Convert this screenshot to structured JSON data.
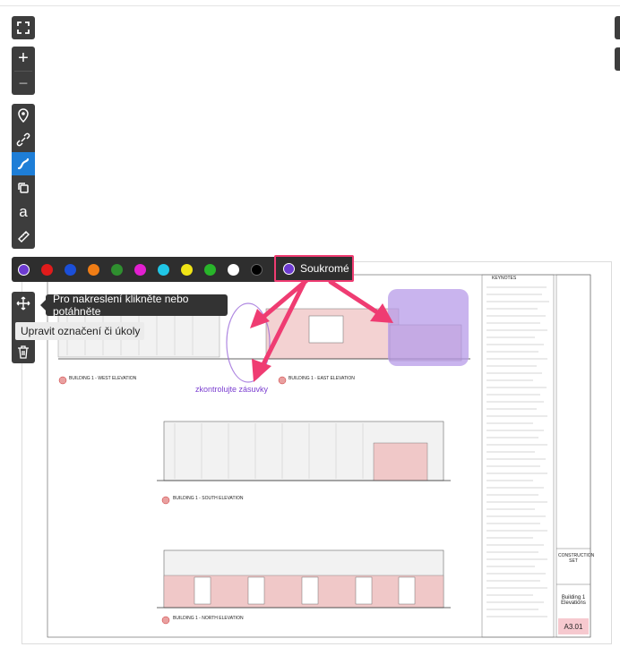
{
  "toolbar": {
    "fullscreen": "fullscreen-icon",
    "zoom_in": "+",
    "zoom_out": "−",
    "text_tool": "a"
  },
  "colors": {
    "accent": "#1e7ed7",
    "annotation_pink": "#ef3c72",
    "annotation_purple": "#8b58d6",
    "palette": [
      "#6d3bd1",
      "#e11b1b",
      "#1b4fd8",
      "#f07d15",
      "#2f8f2f",
      "#e21fd0",
      "#20c6e6",
      "#f0e416",
      "#28b52a",
      "#ffffff",
      "#000000"
    ]
  },
  "private_button": {
    "label": "Soukromé"
  },
  "tooltip": {
    "text": "Pro nakreslení klikněte nebo potáhněte"
  },
  "edit_label": {
    "text": "Upravit označení či úkoly"
  },
  "annotation": {
    "text": "zkontrolujte zásuvky"
  },
  "drawing": {
    "keynotes_header": "KEYNOTES",
    "west_elevation": "BUILDING 1 - WEST ELEVATION",
    "east_elevation": "BUILDING 1 - EAST ELEVATION",
    "south_elevation": "BUILDING 1 - SOUTH ELEVATION",
    "north_elevation": "BUILDING 1 - NORTH ELEVATION",
    "stamp_title": "CONSTRUCTION SET",
    "sheet_title": "Building 1 Elevations",
    "sheet_number": "A3.01"
  }
}
